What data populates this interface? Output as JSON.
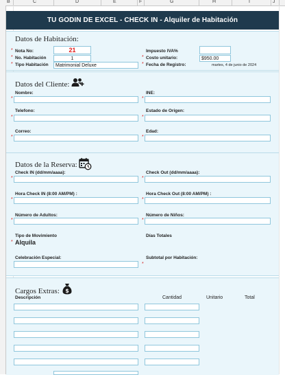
{
  "sheet": {
    "columns": [
      "B",
      "C",
      "D",
      "E",
      "F",
      "G",
      "H",
      "I",
      "J"
    ]
  },
  "header": {
    "title": "TU GODIN DE EXCEL - CHECK IN - Alquiler de Habitación"
  },
  "habitacion": {
    "section_title": "Datos de Habitación:",
    "nota_label": "Nota No:",
    "nota_value": "21",
    "numero_label": "No. Habitación",
    "numero_value": "1",
    "tipo_label": "Tipo Habitación",
    "tipo_value": "Matrimonial Deluxe",
    "impuesto_label": "Impuesto IVA%",
    "impuesto_value": "",
    "costo_label": "Costo unitario:",
    "costo_value": "$950.00",
    "fecha_label": "Fecha de Registro:",
    "fecha_value": "martes, 4 de junio de 2024"
  },
  "cliente": {
    "section_title": "Datos del Cliente:",
    "nombre_label": "Nombre:",
    "telefono_label": "Telefono:",
    "correo_label": "Correo:",
    "ine_label": "INE:",
    "estado_label": "Estado de Origen:",
    "edad_label": "Edad:"
  },
  "reserva": {
    "section_title": "Datos de la Reserva:",
    "checkin_label": "Check IN (dd/mm/aaaa):",
    "checkout_label": "Check Out (dd/mm/aaaa):",
    "hora_in_label": "Hora Check IN (8:00 AM/PM) :",
    "hora_out_label": "Hora Check Out (8:00 AM/PM) :",
    "adultos_label": "Número de Adultos:",
    "ninos_label": "Número de Niños:",
    "movimiento_label": "Tipo de Movimiento",
    "movimiento_value": "Alquila",
    "dias_label": "Días Totales",
    "celebracion_label": "Celebración Especial:",
    "subtotal_label": "Subtotal por Habitación:"
  },
  "cargos": {
    "section_title": "Cargos Extras:",
    "col_descripcion": "Descripción",
    "col_cantidad": "Cantidad",
    "col_unitario": "Unitario",
    "col_total": "Total"
  },
  "icons": {
    "user_icon": "users-icon",
    "calendar_icon": "calendar-clock-icon",
    "money_icon": "money-bag-icon"
  },
  "colors": {
    "title_bg": "#1f3a4d",
    "panel_bg": "#eaf6fb",
    "field_border": "#8fc6dc",
    "required_star": "#d62020",
    "highlight_red": "#e01b1b"
  }
}
